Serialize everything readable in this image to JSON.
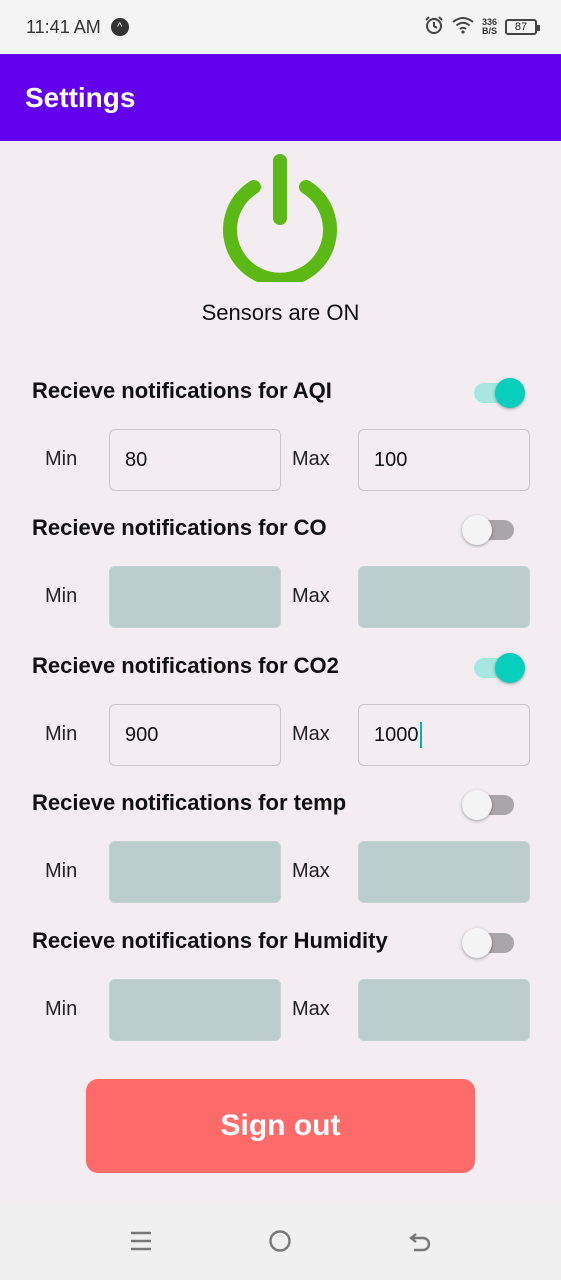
{
  "status_bar": {
    "time": "11:41 AM",
    "nav_badge": "^",
    "speed_top": "336",
    "speed_bottom": "B/S",
    "battery": "87",
    "icons": [
      "alarm-icon",
      "wifi-icon"
    ]
  },
  "app_bar": {
    "title": "Settings"
  },
  "power": {
    "status_text": "Sensors are ON",
    "icon": "power-icon",
    "color": "#5cb815"
  },
  "sections": [
    {
      "title": "Recieve notifications for AQI",
      "enabled": true,
      "min_label": "Min",
      "max_label": "Max",
      "min_value": "80",
      "max_value": "100"
    },
    {
      "title": "Recieve notifications for CO",
      "enabled": false,
      "min_label": "Min",
      "max_label": "Max",
      "min_value": "",
      "max_value": ""
    },
    {
      "title": "Recieve notifications for CO2",
      "enabled": true,
      "min_label": "Min",
      "max_label": "Max",
      "min_value": "900",
      "max_value": "1000"
    },
    {
      "title": "Recieve notifications for temp",
      "enabled": false,
      "min_label": "Min",
      "max_label": "Max",
      "min_value": "",
      "max_value": ""
    },
    {
      "title": "Recieve notifications for Humidity",
      "enabled": false,
      "min_label": "Min",
      "max_label": "Max",
      "min_value": "",
      "max_value": ""
    }
  ],
  "signout": {
    "label": "Sign out",
    "color": "#ff6b6b"
  },
  "colors": {
    "app_bar": "#6200ee",
    "switch_on": "#06d0bd",
    "disabled_field": "#bacdcc"
  },
  "bottom_nav": {
    "icons": [
      "menu-icon",
      "home-icon",
      "back-icon"
    ]
  }
}
